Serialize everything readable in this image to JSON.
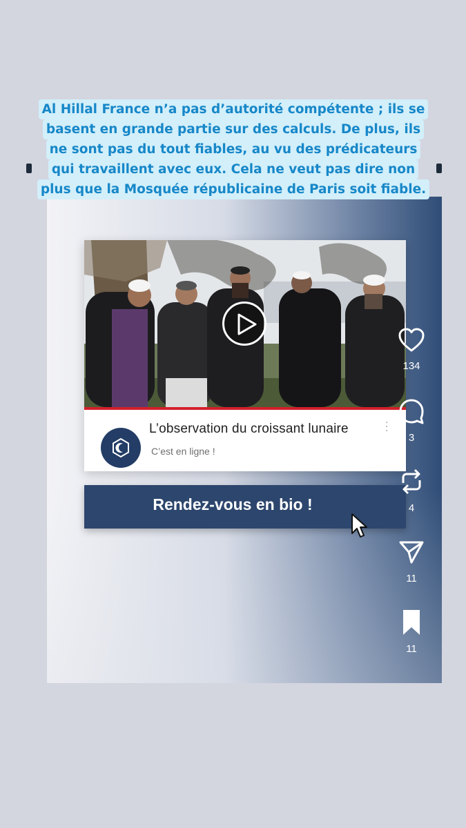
{
  "caption": {
    "lines": [
      "Al Hillal France n’a pas d’autorité compétente ; ils se",
      "basent en grande partie sur des calculs. De plus, ils",
      "ne sont pas du tout fiables, au vu des prédicateurs",
      "qui travaillent avec eux. Cela ne veut pas dire non",
      "plus que la Mosquée républicaine de Paris soit fiable."
    ],
    "text_color": "#1787c8",
    "background": "#d2effa"
  },
  "video": {
    "title": "L’observation du croissant lunaire",
    "subtitle": "C’est en ligne !",
    "progress_fraction": 1.0,
    "progress_color": "#d3202a",
    "play_icon": "play-icon",
    "channel_icon": "hexagon-crescent-icon"
  },
  "cta": {
    "label": "Rendez-vous en bio !",
    "background": "#2d466d",
    "cursor_icon": "pointer-cursor-icon"
  },
  "actions": {
    "like": {
      "icon": "heart-icon",
      "count": "134"
    },
    "comment": {
      "icon": "comment-icon",
      "count": "3"
    },
    "repost": {
      "icon": "repost-icon",
      "count": "4"
    },
    "share": {
      "icon": "send-icon",
      "count": "11"
    },
    "save": {
      "icon": "bookmark-icon",
      "count": "11"
    }
  }
}
